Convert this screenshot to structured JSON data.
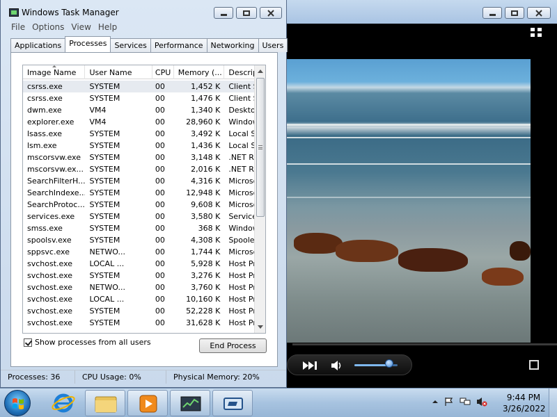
{
  "task_manager": {
    "title": "Windows Task Manager",
    "menu": [
      "File",
      "Options",
      "View",
      "Help"
    ],
    "tabs": [
      "Applications",
      "Processes",
      "Services",
      "Performance",
      "Networking",
      "Users"
    ],
    "active_tab": "Processes",
    "columns": [
      "Image Name",
      "User Name",
      "CPU",
      "Memory (...",
      "Description"
    ],
    "rows": [
      [
        "csrss.exe",
        "SYSTEM",
        "00",
        "1,452 K",
        "Client Ser..."
      ],
      [
        "csrss.exe",
        "SYSTEM",
        "00",
        "1,476 K",
        "Client Ser..."
      ],
      [
        "dwm.exe",
        "VM4",
        "00",
        "1,340 K",
        "Desktop ..."
      ],
      [
        "explorer.exe",
        "VM4",
        "00",
        "28,960 K",
        "Windows ..."
      ],
      [
        "lsass.exe",
        "SYSTEM",
        "00",
        "3,492 K",
        "Local Sec..."
      ],
      [
        "lsm.exe",
        "SYSTEM",
        "00",
        "1,436 K",
        "Local Ses..."
      ],
      [
        "mscorsvw.exe",
        "SYSTEM",
        "00",
        "3,148 K",
        ".NET Run..."
      ],
      [
        "mscorsvw.ex...",
        "SYSTEM",
        "00",
        "2,016 K",
        ".NET Run..."
      ],
      [
        "SearchFilterH...",
        "SYSTEM",
        "00",
        "4,316 K",
        "Microsoft ..."
      ],
      [
        "SearchIndexe...",
        "SYSTEM",
        "00",
        "12,948 K",
        "Microsoft ..."
      ],
      [
        "SearchProtoc...",
        "SYSTEM",
        "00",
        "9,608 K",
        "Microsoft ..."
      ],
      [
        "services.exe",
        "SYSTEM",
        "00",
        "3,580 K",
        "Services ..."
      ],
      [
        "smss.exe",
        "SYSTEM",
        "00",
        "368 K",
        "Windows ..."
      ],
      [
        "spoolsv.exe",
        "SYSTEM",
        "00",
        "4,308 K",
        "Spooler S..."
      ],
      [
        "sppsvc.exe",
        "NETWO...",
        "00",
        "1,744 K",
        "Microsoft ..."
      ],
      [
        "svchost.exe",
        "LOCAL ...",
        "00",
        "5,928 K",
        "Host Proc..."
      ],
      [
        "svchost.exe",
        "SYSTEM",
        "00",
        "3,276 K",
        "Host Proc..."
      ],
      [
        "svchost.exe",
        "NETWO...",
        "00",
        "3,760 K",
        "Host Proc..."
      ],
      [
        "svchost.exe",
        "LOCAL ...",
        "00",
        "10,160 K",
        "Host Proc..."
      ],
      [
        "svchost.exe",
        "SYSTEM",
        "00",
        "52,228 K",
        "Host Proc..."
      ],
      [
        "svchost.exe",
        "SYSTEM",
        "00",
        "31,628 K",
        "Host Proc..."
      ]
    ],
    "show_all_label": "Show processes from all users",
    "end_process_label": "End Process",
    "status": {
      "processes": "Processes: 36",
      "cpu": "CPU Usage: 0%",
      "memory": "Physical Memory: 20%"
    }
  },
  "media_player": {
    "volume_fraction": 0.8
  },
  "taskbar": {
    "time": "9:44 PM",
    "date": "3/26/2022"
  },
  "colors": {
    "accent": "#3a82d0",
    "titlebar": "#c5d9ee"
  }
}
